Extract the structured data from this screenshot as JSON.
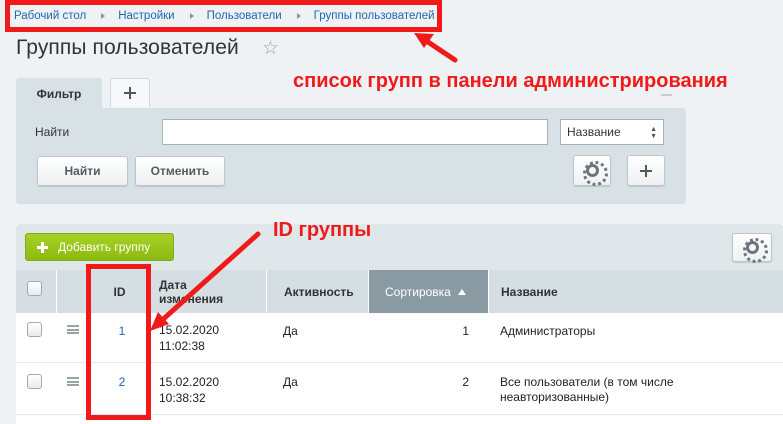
{
  "breadcrumb": [
    "Рабочий стол",
    "Настройки",
    "Пользователи",
    "Группы пользователей"
  ],
  "page_title": "Группы пользователей",
  "filter": {
    "tab_label": "Фильтр",
    "find_label": "Найти",
    "search_value": "",
    "select_value": "Название",
    "find_button": "Найти",
    "cancel_button": "Отменить"
  },
  "toolbar": {
    "add_button": "Добавить группу"
  },
  "table": {
    "columns": [
      "ID",
      "Дата изменения",
      "Активность",
      "Сортировка",
      "Название"
    ],
    "sorted_column": "Сортировка",
    "rows": [
      {
        "id": "1",
        "date": "15.02.2020",
        "time": "11:02:38",
        "active": "Да",
        "sort": "1",
        "name": "Администраторы"
      },
      {
        "id": "2",
        "date": "15.02.2020",
        "time": "10:38:32",
        "active": "Да",
        "sort": "2",
        "name": "Все пользователи (в том числе неавторизованные)"
      }
    ]
  },
  "annotations": {
    "panel_note": "список групп в панели администрирования",
    "id_note": "ID группы"
  },
  "colors": {
    "annotation": "#f01a1a",
    "link": "#2067b0",
    "add_button": "#8bbb12",
    "sorted_header": "#8a9aa3"
  },
  "icons": [
    "star-icon",
    "plus-icon",
    "gear-icon",
    "menu-icon",
    "sort-asc-icon",
    "arrow-icon"
  ]
}
